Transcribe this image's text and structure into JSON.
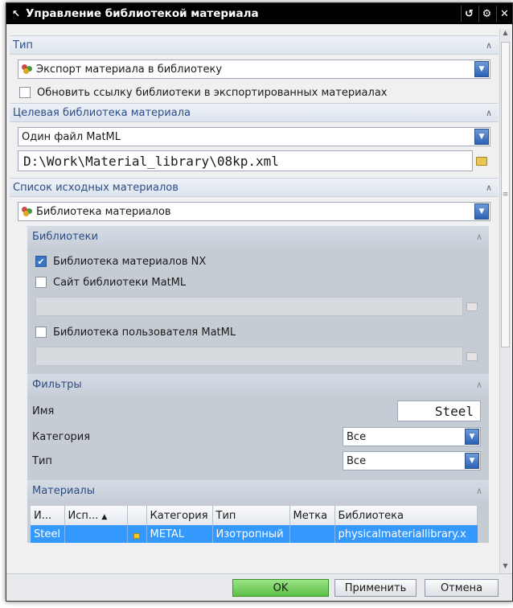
{
  "window": {
    "title": "Управление библиотекой материала",
    "controls": [
      "reset-icon",
      "gear-icon",
      "close-icon"
    ]
  },
  "type_section": {
    "header": "Тип",
    "dropdown_value": "Экспорт материала в библиотеку"
  },
  "update_link_checkbox": {
    "label": "Обновить ссылку библиотеки в экспортированных материалах",
    "checked": false
  },
  "target_section": {
    "header": "Целевая библиотека материала",
    "dropdown_value": "Один файл MatML",
    "path_value": "D:\\Work\\Material_library\\08kp.xml"
  },
  "source_section": {
    "header": "Список исходных материалов",
    "dropdown_value": "Библиотека материалов"
  },
  "libraries": {
    "header": "Библиотеки",
    "nx_library": {
      "label": "Библиотека материалов NX",
      "checked": true
    },
    "matml_site": {
      "label": "Сайт библиотеки MatML",
      "checked": false
    },
    "matml_user": {
      "label": "Библиотека пользователя MatML",
      "checked": false
    }
  },
  "filters": {
    "header": "Фильтры",
    "name_label": "Имя",
    "name_value": "Steel",
    "category_label": "Категория",
    "category_value": "Все",
    "type_label": "Тип",
    "type_value": "Все"
  },
  "materials": {
    "header": "Материалы",
    "columns": [
      "И...",
      "Исп...",
      "",
      "Категория",
      "Тип",
      "Метка",
      "Библиотека"
    ],
    "rows": [
      {
        "name": "Steel",
        "used": "",
        "lock": "lock-icon",
        "category": "METAL",
        "type": "Изотропный",
        "label": "",
        "library": "physicalmateriallibrary.x"
      }
    ]
  },
  "buttons": {
    "ok": "OK",
    "apply": "Применить",
    "cancel": "Отмена"
  },
  "colors": {
    "selection": "#3399ff",
    "header_text": "#2b4c86",
    "ok_button": "#7fd36b"
  }
}
